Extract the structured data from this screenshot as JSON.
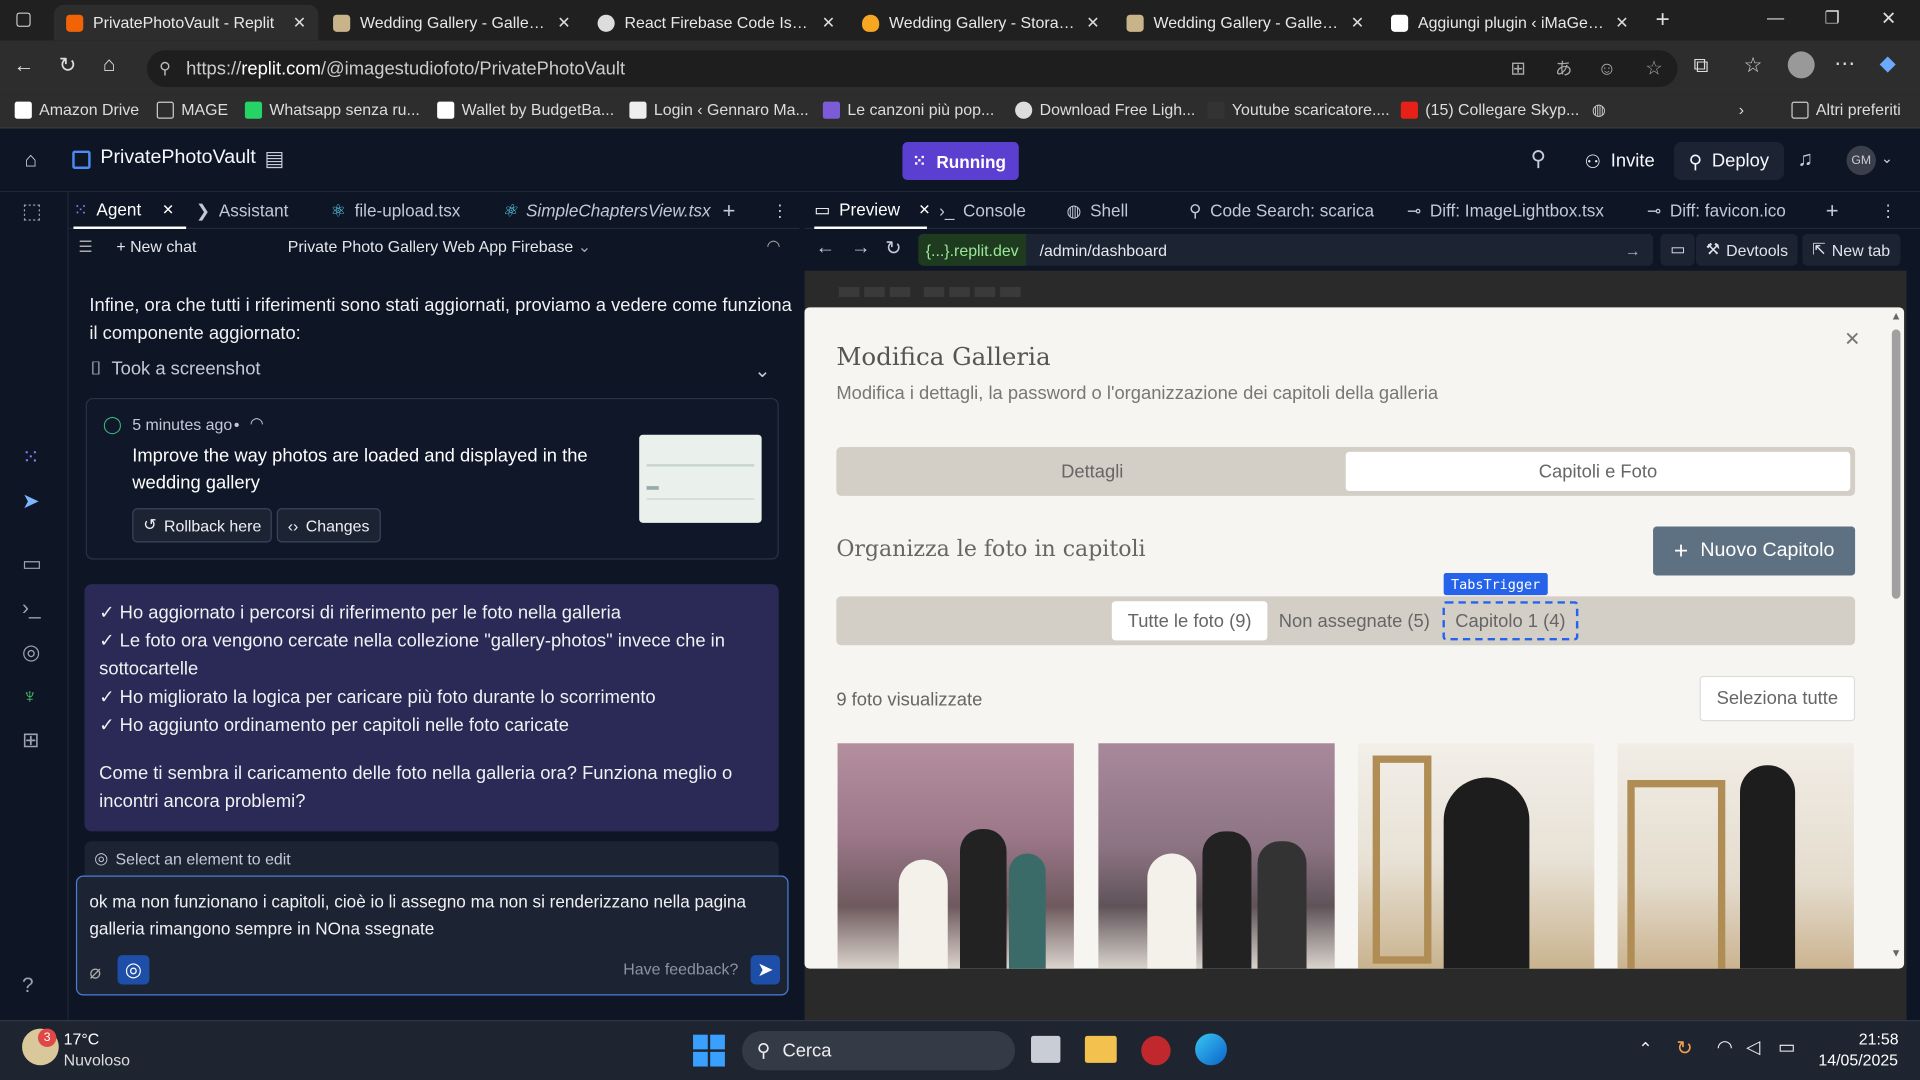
{
  "browser": {
    "tabs": [
      {
        "title": "PrivatePhotoVault - Replit",
        "active": true
      },
      {
        "title": "Wedding Gallery - Gallerie Fo"
      },
      {
        "title": "React Firebase Code Issues"
      },
      {
        "title": "Wedding Gallery - Storage -"
      },
      {
        "title": "Wedding Gallery - Gallerie Fo"
      },
      {
        "title": "Aggiungi plugin ‹ iMaGe stu"
      }
    ],
    "url_prefix": "https://",
    "url_host": "replit.com",
    "url_path": "/@imagestudiofoto/PrivatePhotoVault",
    "bookmarks": [
      "Amazon Drive",
      "MAGE",
      "Whatsapp senza ru...",
      "Wallet by BudgetBa...",
      "Login ‹ Gennaro Ma...",
      "Le canzoni più pop...",
      "Download Free Ligh...",
      "Youtube scaricatore....",
      "(15) Collegare Skyp..."
    ],
    "other_bookmarks": "Altri preferiti"
  },
  "replit": {
    "project": "PrivatePhotoVault",
    "run_label": "Running",
    "invite": "Invite",
    "deploy": "Deploy",
    "avatar": "GM"
  },
  "agent": {
    "tabs": [
      "Agent",
      "Assistant",
      "file-upload.tsx",
      "SimpleChaptersView.tsx"
    ],
    "new_chat": "New chat",
    "chat_title": "Private Photo Gallery Web App Firebase",
    "intro_line1": "Infine, ora che tutti i riferimenti sono stati aggiornati, proviamo a vedere come funziona",
    "intro_line2": "il componente aggiornato:",
    "screenshot_label": "Took a screenshot",
    "checkpoint_time": "5 minutes ago",
    "checkpoint_sep": "•",
    "checkpoint_line1": "Improve the way photos are loaded and displayed in the",
    "checkpoint_line2": "wedding gallery",
    "rollback": "Rollback here",
    "changes": "Changes",
    "bubble_lines": [
      "✓ Ho aggiornato i percorsi di riferimento per le foto nella galleria",
      "✓ Le foto ora vengono cercate nella collezione \"gallery-photos\" invece che in",
      "sottocartelle",
      "✓ Ho migliorato la logica per caricare più foto durante lo scorrimento",
      "✓ Ho aggiunto ordinamento per capitoli nelle foto caricate"
    ],
    "bubble_question1": "Come ti sembra il caricamento delle foto nella galleria ora? Funziona meglio o",
    "bubble_question2": "incontri ancora problemi?",
    "select_element": "Select an element to edit",
    "input_line1": "ok ma non funzionano i capitoli, cioè io li assegno ma non si renderizzano nella pagina",
    "input_line2": "galleria rimangono sempre in NOna ssegnate",
    "feedback": "Have feedback?"
  },
  "preview": {
    "tabs": [
      "Preview",
      "Console",
      "Shell",
      "Code Search: scarica",
      "Diff: ImageLightbox.tsx",
      "Diff: favicon.ico"
    ],
    "dev_badge": "{...}.replit.dev",
    "path": "/admin/dashboard",
    "devtools": "Devtools",
    "new_tab": "New tab"
  },
  "modal": {
    "title": "Modifica Galleria",
    "subtitle": "Modifica i dettagli, la password o l'organizzazione dei capitoli della galleria",
    "tab_details": "Dettagli",
    "tab_chapters": "Capitoli e Foto",
    "organize": "Organizza le foto in capitoli",
    "new_chapter": "Nuovo Capitolo",
    "tabs_trigger": "TabsTrigger",
    "chapter_tabs": [
      "Tutte le foto (9)",
      "Non assegnate (5)",
      "Capitolo 1 (4)"
    ],
    "count": "9 foto visualizzate",
    "select_all": "Seleziona tutte"
  },
  "taskbar": {
    "weather_temp": "17°C",
    "weather_desc": "Nuvoloso",
    "weather_badge": "3",
    "search": "Cerca",
    "time": "21:58",
    "date": "14/05/2025"
  },
  "colors": {
    "run": "#5b3fd1",
    "bubble": "#2b2955",
    "new_chapter": "#5d7183",
    "tabs_trigger": "#2563eb"
  }
}
